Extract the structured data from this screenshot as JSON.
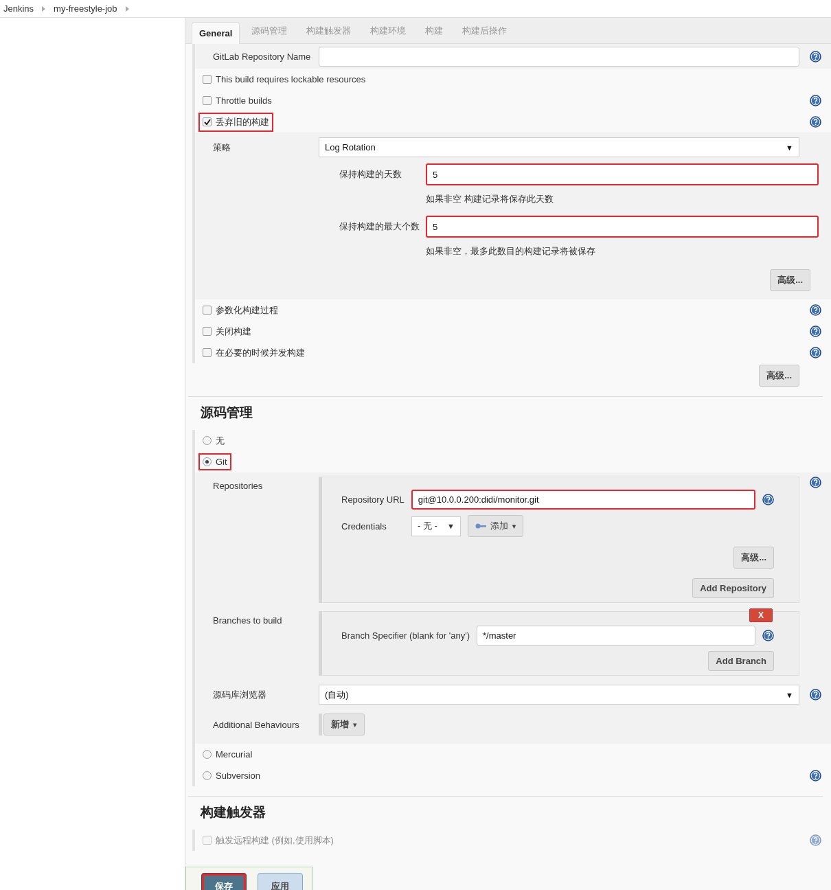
{
  "breadcrumbs": [
    "Jenkins",
    "my-freestyle-job"
  ],
  "tabs": [
    {
      "label": "General",
      "selected": true
    },
    {
      "label": "源码管理",
      "selected": false
    },
    {
      "label": "构建触发器",
      "selected": false
    },
    {
      "label": "构建环境",
      "selected": false
    },
    {
      "label": "构建",
      "selected": false
    },
    {
      "label": "构建后操作",
      "selected": false
    }
  ],
  "general": {
    "gitlab_field": {
      "label": "GitLab Repository Name"
    },
    "options": [
      {
        "label": "This build requires lockable resources",
        "checked": false,
        "help": false,
        "highlighted": false
      },
      {
        "label": "Throttle builds",
        "checked": false,
        "help": true,
        "highlighted": false
      },
      {
        "label": "丢弃旧的构建",
        "checked": true,
        "help": true,
        "highlighted": true
      }
    ],
    "discard": {
      "strategy_label": "策略",
      "strategy": "Log Rotation",
      "strategy_caret": "▼",
      "fields": [
        {
          "label": "保持构建的天数",
          "value": "5",
          "hint": "如果非空  构建记录将保存此天数",
          "highlighted": true
        },
        {
          "label": "保持构建的最大个数",
          "value": "5",
          "hint": "如果非空，最多此数目的构建记录将被保存",
          "highlighted": true
        }
      ],
      "advanced": "高级..."
    },
    "more_options": [
      {
        "label": "参数化构建过程",
        "checked": false
      },
      {
        "label": "关闭构建",
        "checked": false
      },
      {
        "label": "在必要的时候并发构建",
        "checked": false
      }
    ],
    "advanced": "高级..."
  },
  "scm": {
    "title": "源码管理",
    "options": [
      {
        "label": "无",
        "selected": false,
        "help": false,
        "highlighted": false
      },
      {
        "label": "Git",
        "selected": true,
        "help": false,
        "highlighted": true
      },
      {
        "label": "Mercurial",
        "selected": false,
        "help": false,
        "highlighted": false
      },
      {
        "label": "Subversion",
        "selected": false,
        "help": true,
        "highlighted": false
      }
    ],
    "git": {
      "repositories_label": "Repositories",
      "url_label": "Repository URL",
      "url": "git@10.0.0.200:didi/monitor.git",
      "url_highlighted": true,
      "credentials_label": "Credentials",
      "credentials": "- 无 -",
      "credentials_caret": "▼",
      "add_label": "添加",
      "add_caret": "▾",
      "advanced": "高级...",
      "add_repository": "Add Repository",
      "branches_label": "Branches to build",
      "delete": "X",
      "branch_label": "Branch Specifier (blank for 'any')",
      "branch": "*/master",
      "add_branch": "Add Branch",
      "browser_label": "源码库浏览器",
      "browser": "(自动)",
      "browser_caret": "▼",
      "behaviours_label": "Additional Behaviours",
      "behaviours_button": "新增",
      "behaviours_caret": "▾"
    }
  },
  "triggers": {
    "title": "构建触发器",
    "options": [
      {
        "label": "触发远程构建 (例如,使用脚本)",
        "checked": false
      }
    ]
  },
  "actions": [
    {
      "label": "保存",
      "kind": "primary",
      "highlighted": true
    },
    {
      "label": "应用",
      "kind": "secondary",
      "highlighted": false
    }
  ]
}
